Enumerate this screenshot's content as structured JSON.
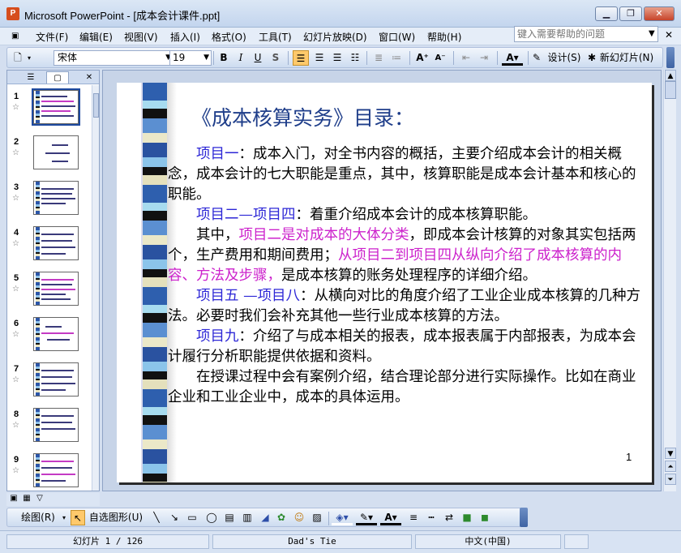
{
  "window": {
    "title": "Microsoft PowerPoint - [成本会计课件.ppt]",
    "app_icon": "P",
    "controls": {
      "minimize": "▁",
      "restore": "❐",
      "close": "✕"
    }
  },
  "menu": {
    "items": [
      "文件(F)",
      "编辑(E)",
      "视图(V)",
      "插入(I)",
      "格式(O)",
      "工具(T)",
      "幻灯片放映(D)",
      "窗口(W)",
      "帮助(H)"
    ],
    "help_placeholder": "键入需要帮助的问题"
  },
  "format_toolbar": {
    "font": "宋体",
    "size": "19",
    "bold": "B",
    "italic": "I",
    "underline": "U",
    "shadow": "S",
    "design": "设计(S)",
    "new_slide": "新幻灯片(N)"
  },
  "panel": {
    "slides": [
      {
        "num": "1",
        "star": "☆"
      },
      {
        "num": "2",
        "star": "☆"
      },
      {
        "num": "3",
        "star": "☆"
      },
      {
        "num": "4",
        "star": "☆"
      },
      {
        "num": "5",
        "star": "☆"
      },
      {
        "num": "6",
        "star": "☆"
      },
      {
        "num": "7",
        "star": "☆"
      },
      {
        "num": "8",
        "star": "☆"
      },
      {
        "num": "9",
        "star": "☆"
      }
    ]
  },
  "slide": {
    "title": "《成本核算实务》目录：",
    "p1_a": "项目一",
    "p1_b": "：成本入门，对全书内容的概括，主要介绍成本会计的相关概念，成本会计的七大职能是重点，其中，核算职能是成本会计基本和核心的职能。",
    "p2_a": "项目二—项目四",
    "p2_b": "：着重介绍成本会计的成本核算职能。",
    "p3_a": "其中，",
    "p3_b": "项目二是对成本的大体分类",
    "p3_c": "，即成本会计核算的对象其实包括两个，生产费用和期间费用；",
    "p3_d": "从项目二到项目四从纵向介绍了成本核算的内容、方法及步骤，",
    "p3_e": "是成本核算的账务处理程序的详细介绍。",
    "p4_a": "项目五 —项目八",
    "p4_b": "：从横向对比的角度介绍了工业企业成本核算的几种方法。必要时我们会补充其他一些行业成本核算的方法。",
    "p5_a": "项目九",
    "p5_b": "：介绍了与成本相关的报表，成本报表属于内部报表，为成本会计履行分析职能提供依据和资料。",
    "p6": "在授课过程中会有案例介绍，结合理论部分进行实际操作。比如在商业企业和工业企业中，成本的具体运用。",
    "page_number": "1"
  },
  "draw_toolbar": {
    "draw": "绘图(R)",
    "autoshapes": "自选图形(U)"
  },
  "status": {
    "slide_info": "幻灯片 1 / 126",
    "design": "Dad's Tie",
    "language": "中文(中国)"
  }
}
